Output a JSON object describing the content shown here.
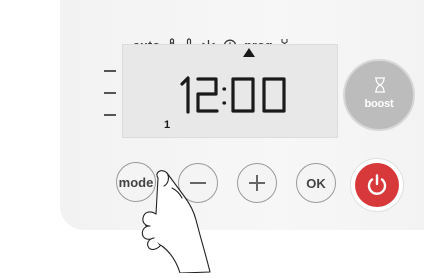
{
  "mode_icons": {
    "auto_label": "auto",
    "prog_label": "prog",
    "icons": [
      "thermometer-icon",
      "thermometer-low-icon",
      "frost-icon",
      "clock-icon",
      "wrench-icon"
    ]
  },
  "display": {
    "time": "12:00",
    "program_index": "1"
  },
  "buttons": {
    "mode_label": "mode",
    "ok_label": "OK",
    "boost_label": "boost"
  },
  "colors": {
    "power_accent": "#d7393b",
    "boost_bg": "#bcbcbc"
  }
}
